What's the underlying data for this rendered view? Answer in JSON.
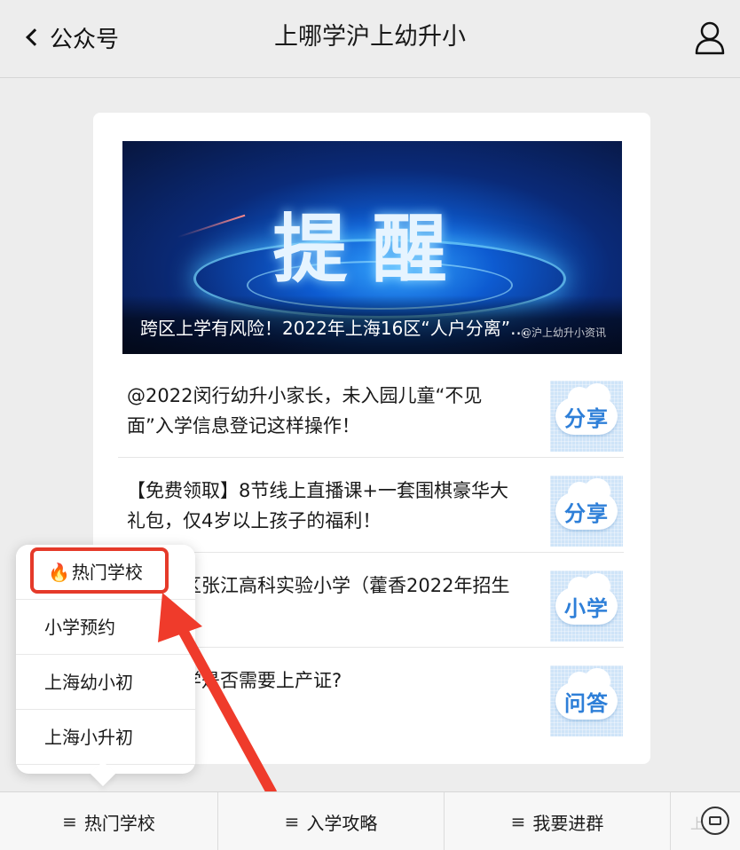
{
  "header": {
    "back_label": "公众号",
    "title": "上哪学沪上幼升小",
    "user_icon": "user-icon"
  },
  "banner": {
    "headline": "提醒",
    "caption": "跨区上学有风险！2022年上海16区“人户分离”...",
    "watermark": "@沪上幼升小资讯"
  },
  "articles": [
    {
      "text": "@2022闵行幼升小家长，未入园儿童“不见面”入学信息登记这样操作！",
      "thumb_label": "分享"
    },
    {
      "text": "【免费领取】8节线上直播课+一套围棋豪华大礼包，仅4岁以上孩子的福利！",
      "thumb_label": "分享"
    },
    {
      "text": "浦东新区张江高科实验小学（藿香2022年招生简章！",
      "thumb_label": "小学"
    },
    {
      "text": "上海入学是否需要上产证?",
      "thumb_label": "问答"
    }
  ],
  "popup_menu": {
    "items": [
      "热门学校",
      "小学预约",
      "上海幼小初",
      "上海小升初"
    ],
    "highlight_color": "#e53a2a"
  },
  "bottom_menu": {
    "tabs": [
      "热门学校",
      "入学攻略",
      "我要进群"
    ],
    "partial_label": "上海",
    "keyboard_icon": "keyboard-icon"
  }
}
